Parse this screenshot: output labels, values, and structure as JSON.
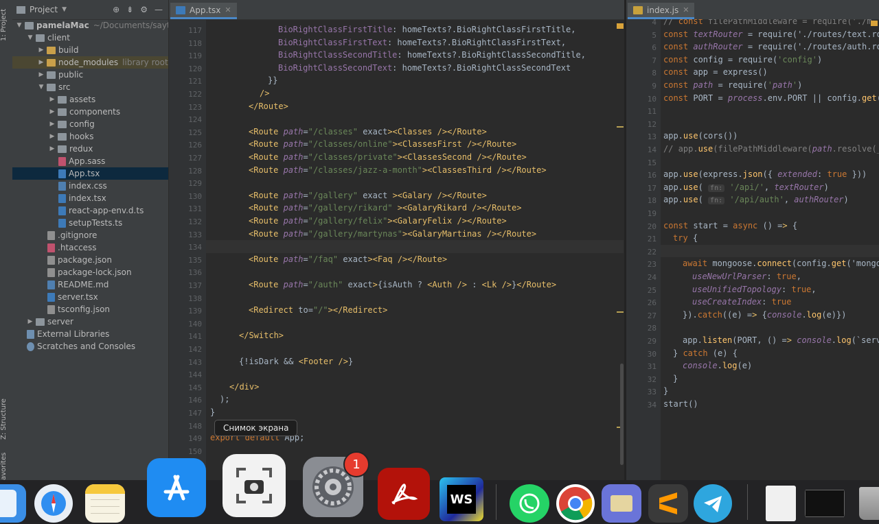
{
  "sidebar_tabs": {
    "project": "1: Project",
    "structure": "Z: Structure",
    "favorites": "avorites"
  },
  "project_panel": {
    "title": "Project",
    "root": {
      "name": "pamelaMac",
      "path": "~/Documents/sayti/pa"
    },
    "items": [
      {
        "label": "client",
        "hint": ""
      },
      {
        "label": "build",
        "hint": ""
      },
      {
        "label": "node_modules",
        "hint": "library root"
      },
      {
        "label": "public",
        "hint": ""
      },
      {
        "label": "src",
        "hint": ""
      },
      {
        "label": "assets",
        "hint": ""
      },
      {
        "label": "components",
        "hint": ""
      },
      {
        "label": "config",
        "hint": ""
      },
      {
        "label": "hooks",
        "hint": ""
      },
      {
        "label": "redux",
        "hint": ""
      },
      {
        "label": "App.sass",
        "hint": ""
      },
      {
        "label": "App.tsx",
        "hint": ""
      },
      {
        "label": "index.css",
        "hint": ""
      },
      {
        "label": "index.tsx",
        "hint": ""
      },
      {
        "label": "react-app-env.d.ts",
        "hint": ""
      },
      {
        "label": "setupTests.ts",
        "hint": ""
      },
      {
        "label": ".gitignore",
        "hint": ""
      },
      {
        "label": ".htaccess",
        "hint": ""
      },
      {
        "label": "package.json",
        "hint": ""
      },
      {
        "label": "package-lock.json",
        "hint": ""
      },
      {
        "label": "README.md",
        "hint": ""
      },
      {
        "label": "server.tsx",
        "hint": ""
      },
      {
        "label": "tsconfig.json",
        "hint": ""
      },
      {
        "label": "server",
        "hint": ""
      },
      {
        "label": "External Libraries",
        "hint": ""
      },
      {
        "label": "Scratches and Consoles",
        "hint": ""
      }
    ]
  },
  "editor_left": {
    "tab": "App.tsx",
    "line_numbers": [
      "117",
      "118",
      "119",
      "120",
      "121",
      "122",
      "123",
      "124",
      "125",
      "126",
      "127",
      "128",
      "129",
      "130",
      "131",
      "132",
      "133",
      "134",
      "135",
      "136",
      "137",
      "138",
      "139",
      "140",
      "141",
      "142",
      "143",
      "144",
      "145",
      "146",
      "147",
      "148",
      "149",
      "150"
    ],
    "lines": [
      "BioRightClassFirstTitle: homeTexts?.BioRightClassFirstTitle,",
      "BioRightClassFirstText: homeTexts?.BioRightClassFirstText,",
      "BioRightClassSecondTitle: homeTexts?.BioRightClassSecondTitle,",
      "BioRightClassSecondText: homeTexts?.BioRightClassSecondText",
      "}}",
      "/>",
      "</Route>",
      "",
      "<Route path=\"/classes\" exact><Classes /></Route>",
      "<Route path=\"/classes/online\"><ClassesFirst /></Route>",
      "<Route path=\"/classes/private\"><ClassesSecond /></Route>",
      "<Route path=\"/classes/jazz-a-month\"><ClassesThird /></Route>",
      "",
      "<Route path=\"/gallery\" exact ><Galary /></Route>",
      "<Route path=\"/gallery/rikard\" ><GalaryRikard /></Route>",
      "<Route path=\"/gallery/felix\"><GalaryFelix /></Route>",
      "<Route path=\"/gallery/martynas\"><GalaryMartinas /></Route>",
      "",
      "<Route path=\"/faq\" exact><Faq /></Route>",
      "",
      "<Route path=\"/auth\" exact>{isAuth ? <Auth /> : <Lk />}</Route>",
      "",
      "<Redirect to=\"/\"></Redirect>",
      "",
      "</Switch>",
      "",
      "{!isDark && <Footer />}",
      "",
      "</div>",
      ");",
      "}",
      "",
      "export default App;",
      ""
    ]
  },
  "editor_right": {
    "tab": "index.js",
    "line_numbers": [
      "4",
      "5",
      "6",
      "7",
      "8",
      "9",
      "10",
      "11",
      "12",
      "13",
      "14",
      "15",
      "16",
      "17",
      "18",
      "19",
      "20",
      "21",
      "22",
      "23",
      "24",
      "25",
      "26",
      "27",
      "28",
      "29",
      "30",
      "31",
      "32",
      "33",
      "34"
    ],
    "lines": [
      "// const filePathMiddleware = require('./m",
      "const textRouter = require('./routes/text.ro",
      "const authRouter = require('./routes/auth.ro",
      "const config = require('config')",
      "const app = express()",
      "const path = require('path')",
      "const PORT = process.env.PORT || config.get(",
      "",
      "",
      "app.use(cors())",
      "// app.use(filePathMiddleware(path.resolve(_",
      "",
      "app.use(express.json({ extended: true }))",
      "app.use( fn: '/api/', textRouter)",
      "app.use( fn: '/api/auth', authRouter)",
      "",
      "const start = async () => {",
      "try {",
      "",
      "await mongoose.connect(config.get('mongo",
      "useNewUrlParser: true,",
      "useUnifiedTopology: true,",
      "useCreateIndex: true",
      "}).catch((e) => {console.log(e)})",
      "",
      "app.listen(PORT, () => console.log(`serv",
      "} catch (e) {",
      "console.log(e)",
      "}",
      "}",
      "start()"
    ]
  },
  "tooltip": "Снимок экрана",
  "dock": {
    "settings_badge": "1",
    "apps": [
      "finder-icon",
      "safari-icon",
      "notes-icon",
      "app-store-icon",
      "screenshot-icon",
      "system-preferences-icon",
      "acrobat-icon",
      "webstorm-icon",
      "whatsapp-icon",
      "chrome-icon",
      "transmit-icon",
      "sublime-text-icon",
      "telegram-icon",
      "documents-icon",
      "terminal-icon",
      "trash-icon"
    ],
    "webstorm_label": "WS"
  }
}
